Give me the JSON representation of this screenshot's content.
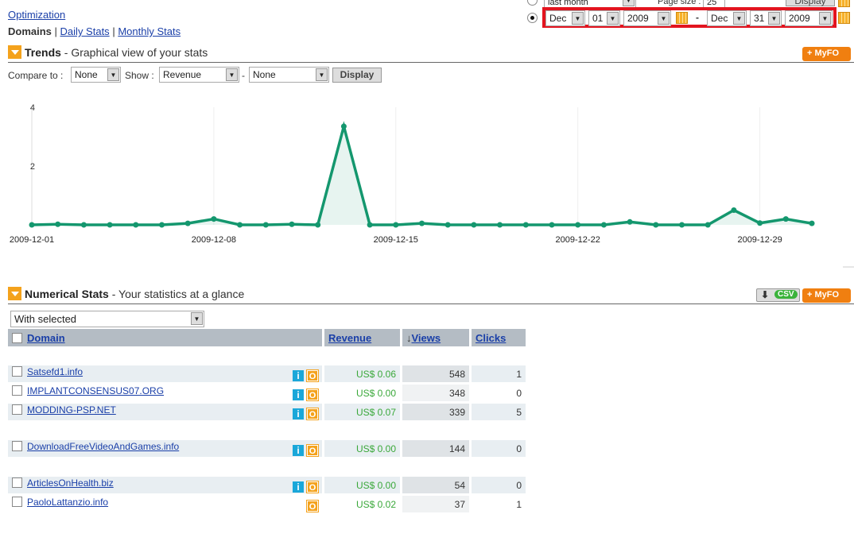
{
  "nav": {
    "optimization": "Optimization",
    "domains": "Domains",
    "daily": "Daily Stats",
    "monthly": "Monthly Stats",
    "sep": "|"
  },
  "period": {
    "preset_value": "last month",
    "page_size_label": "Page size :",
    "page_size": "25",
    "display": "Display",
    "from": {
      "month": "Dec",
      "day": "01",
      "year": "2009"
    },
    "dash": "-",
    "to": {
      "month": "Dec",
      "day": "31",
      "year": "2009"
    }
  },
  "trends": {
    "title": "Trends",
    "subtitle": " - Graphical view of your stats",
    "myfo": "+ MyFO",
    "compare_label": "Compare to :",
    "compare_value": "None",
    "show_label": "Show :",
    "show_value": "Revenue",
    "dash": "-",
    "show2_value": "None",
    "display": "Display"
  },
  "chart_data": {
    "type": "line",
    "color": "#14976e",
    "ylim": [
      0,
      4
    ],
    "y_ticks": [
      "2",
      "4"
    ],
    "x_ticks": [
      "2009-12-01",
      "2009-12-08",
      "2009-12-15",
      "2009-12-22",
      "2009-12-29"
    ],
    "x": [
      "2009-12-01",
      "2009-12-02",
      "2009-12-03",
      "2009-12-04",
      "2009-12-05",
      "2009-12-06",
      "2009-12-07",
      "2009-12-08",
      "2009-12-09",
      "2009-12-10",
      "2009-12-11",
      "2009-12-12",
      "2009-12-13",
      "2009-12-14",
      "2009-12-15",
      "2009-12-16",
      "2009-12-17",
      "2009-12-18",
      "2009-12-19",
      "2009-12-20",
      "2009-12-21",
      "2009-12-22",
      "2009-12-23",
      "2009-12-24",
      "2009-12-25",
      "2009-12-26",
      "2009-12-27",
      "2009-12-28",
      "2009-12-29",
      "2009-12-30",
      "2009-12-31"
    ],
    "values": [
      0,
      0.02,
      0,
      0,
      0,
      0,
      0.05,
      0.2,
      0,
      0,
      0.02,
      0,
      3.35,
      0,
      0,
      0.05,
      0,
      0,
      0,
      0,
      0,
      0,
      0,
      0.1,
      0,
      0,
      0,
      0.5,
      0.06,
      0.2,
      0.05
    ]
  },
  "numerical": {
    "title": "Numerical Stats",
    "subtitle": " - Your statistics at a glance",
    "csv": "CSV",
    "myfo": "+ MyFO",
    "with_selected": "With selected",
    "columns": {
      "domain": "Domain",
      "revenue": "Revenue",
      "views": "Views",
      "clicks": "Clicks"
    },
    "rows": [
      {
        "domain": "Satsefd1.info",
        "revenue": "US$ 0.06",
        "views": "548",
        "clicks": "1",
        "info": true
      },
      {
        "domain": "IMPLANTCONSENSUS07.ORG",
        "revenue": "US$ 0.00",
        "views": "348",
        "clicks": "0",
        "info": true
      },
      {
        "domain": "MODDING-PSP.NET",
        "revenue": "US$ 0.07",
        "views": "339",
        "clicks": "5",
        "info": true
      },
      {
        "domain": "DownloadFreeVideoAndGames.info",
        "revenue": "US$ 0.00",
        "views": "144",
        "clicks": "0",
        "info": true
      },
      {
        "domain": "ArticlesOnHealth.biz",
        "revenue": "US$ 0.00",
        "views": "54",
        "clicks": "0",
        "info": true
      },
      {
        "domain": "PaoloLattanzio.info",
        "revenue": "US$ 0.02",
        "views": "37",
        "clicks": "1",
        "info": false
      }
    ]
  }
}
